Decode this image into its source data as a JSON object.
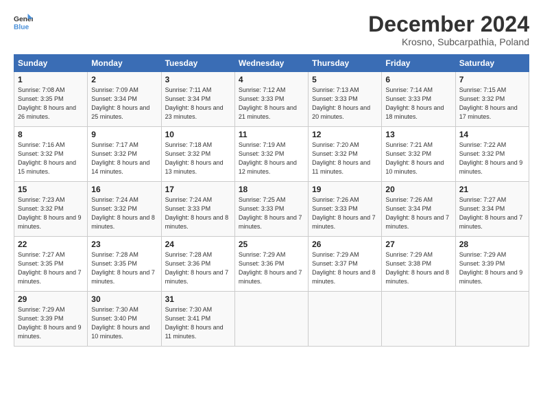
{
  "logo": {
    "general": "General",
    "blue": "Blue"
  },
  "title": "December 2024",
  "location": "Krosno, Subcarpathia, Poland",
  "headers": [
    "Sunday",
    "Monday",
    "Tuesday",
    "Wednesday",
    "Thursday",
    "Friday",
    "Saturday"
  ],
  "weeks": [
    [
      {
        "day": "1",
        "sunrise": "7:08 AM",
        "sunset": "3:35 PM",
        "daylight": "8 hours and 26 minutes."
      },
      {
        "day": "2",
        "sunrise": "7:09 AM",
        "sunset": "3:34 PM",
        "daylight": "8 hours and 25 minutes."
      },
      {
        "day": "3",
        "sunrise": "7:11 AM",
        "sunset": "3:34 PM",
        "daylight": "8 hours and 23 minutes."
      },
      {
        "day": "4",
        "sunrise": "7:12 AM",
        "sunset": "3:33 PM",
        "daylight": "8 hours and 21 minutes."
      },
      {
        "day": "5",
        "sunrise": "7:13 AM",
        "sunset": "3:33 PM",
        "daylight": "8 hours and 20 minutes."
      },
      {
        "day": "6",
        "sunrise": "7:14 AM",
        "sunset": "3:33 PM",
        "daylight": "8 hours and 18 minutes."
      },
      {
        "day": "7",
        "sunrise": "7:15 AM",
        "sunset": "3:32 PM",
        "daylight": "8 hours and 17 minutes."
      }
    ],
    [
      {
        "day": "8",
        "sunrise": "7:16 AM",
        "sunset": "3:32 PM",
        "daylight": "8 hours and 15 minutes."
      },
      {
        "day": "9",
        "sunrise": "7:17 AM",
        "sunset": "3:32 PM",
        "daylight": "8 hours and 14 minutes."
      },
      {
        "day": "10",
        "sunrise": "7:18 AM",
        "sunset": "3:32 PM",
        "daylight": "8 hours and 13 minutes."
      },
      {
        "day": "11",
        "sunrise": "7:19 AM",
        "sunset": "3:32 PM",
        "daylight": "8 hours and 12 minutes."
      },
      {
        "day": "12",
        "sunrise": "7:20 AM",
        "sunset": "3:32 PM",
        "daylight": "8 hours and 11 minutes."
      },
      {
        "day": "13",
        "sunrise": "7:21 AM",
        "sunset": "3:32 PM",
        "daylight": "8 hours and 10 minutes."
      },
      {
        "day": "14",
        "sunrise": "7:22 AM",
        "sunset": "3:32 PM",
        "daylight": "8 hours and 9 minutes."
      }
    ],
    [
      {
        "day": "15",
        "sunrise": "7:23 AM",
        "sunset": "3:32 PM",
        "daylight": "8 hours and 9 minutes."
      },
      {
        "day": "16",
        "sunrise": "7:24 AM",
        "sunset": "3:32 PM",
        "daylight": "8 hours and 8 minutes."
      },
      {
        "day": "17",
        "sunrise": "7:24 AM",
        "sunset": "3:33 PM",
        "daylight": "8 hours and 8 minutes."
      },
      {
        "day": "18",
        "sunrise": "7:25 AM",
        "sunset": "3:33 PM",
        "daylight": "8 hours and 7 minutes."
      },
      {
        "day": "19",
        "sunrise": "7:26 AM",
        "sunset": "3:33 PM",
        "daylight": "8 hours and 7 minutes."
      },
      {
        "day": "20",
        "sunrise": "7:26 AM",
        "sunset": "3:34 PM",
        "daylight": "8 hours and 7 minutes."
      },
      {
        "day": "21",
        "sunrise": "7:27 AM",
        "sunset": "3:34 PM",
        "daylight": "8 hours and 7 minutes."
      }
    ],
    [
      {
        "day": "22",
        "sunrise": "7:27 AM",
        "sunset": "3:35 PM",
        "daylight": "8 hours and 7 minutes."
      },
      {
        "day": "23",
        "sunrise": "7:28 AM",
        "sunset": "3:35 PM",
        "daylight": "8 hours and 7 minutes."
      },
      {
        "day": "24",
        "sunrise": "7:28 AM",
        "sunset": "3:36 PM",
        "daylight": "8 hours and 7 minutes."
      },
      {
        "day": "25",
        "sunrise": "7:29 AM",
        "sunset": "3:36 PM",
        "daylight": "8 hours and 7 minutes."
      },
      {
        "day": "26",
        "sunrise": "7:29 AM",
        "sunset": "3:37 PM",
        "daylight": "8 hours and 8 minutes."
      },
      {
        "day": "27",
        "sunrise": "7:29 AM",
        "sunset": "3:38 PM",
        "daylight": "8 hours and 8 minutes."
      },
      {
        "day": "28",
        "sunrise": "7:29 AM",
        "sunset": "3:39 PM",
        "daylight": "8 hours and 9 minutes."
      }
    ],
    [
      {
        "day": "29",
        "sunrise": "7:29 AM",
        "sunset": "3:39 PM",
        "daylight": "8 hours and 9 minutes."
      },
      {
        "day": "30",
        "sunrise": "7:30 AM",
        "sunset": "3:40 PM",
        "daylight": "8 hours and 10 minutes."
      },
      {
        "day": "31",
        "sunrise": "7:30 AM",
        "sunset": "3:41 PM",
        "daylight": "8 hours and 11 minutes."
      },
      null,
      null,
      null,
      null
    ]
  ]
}
